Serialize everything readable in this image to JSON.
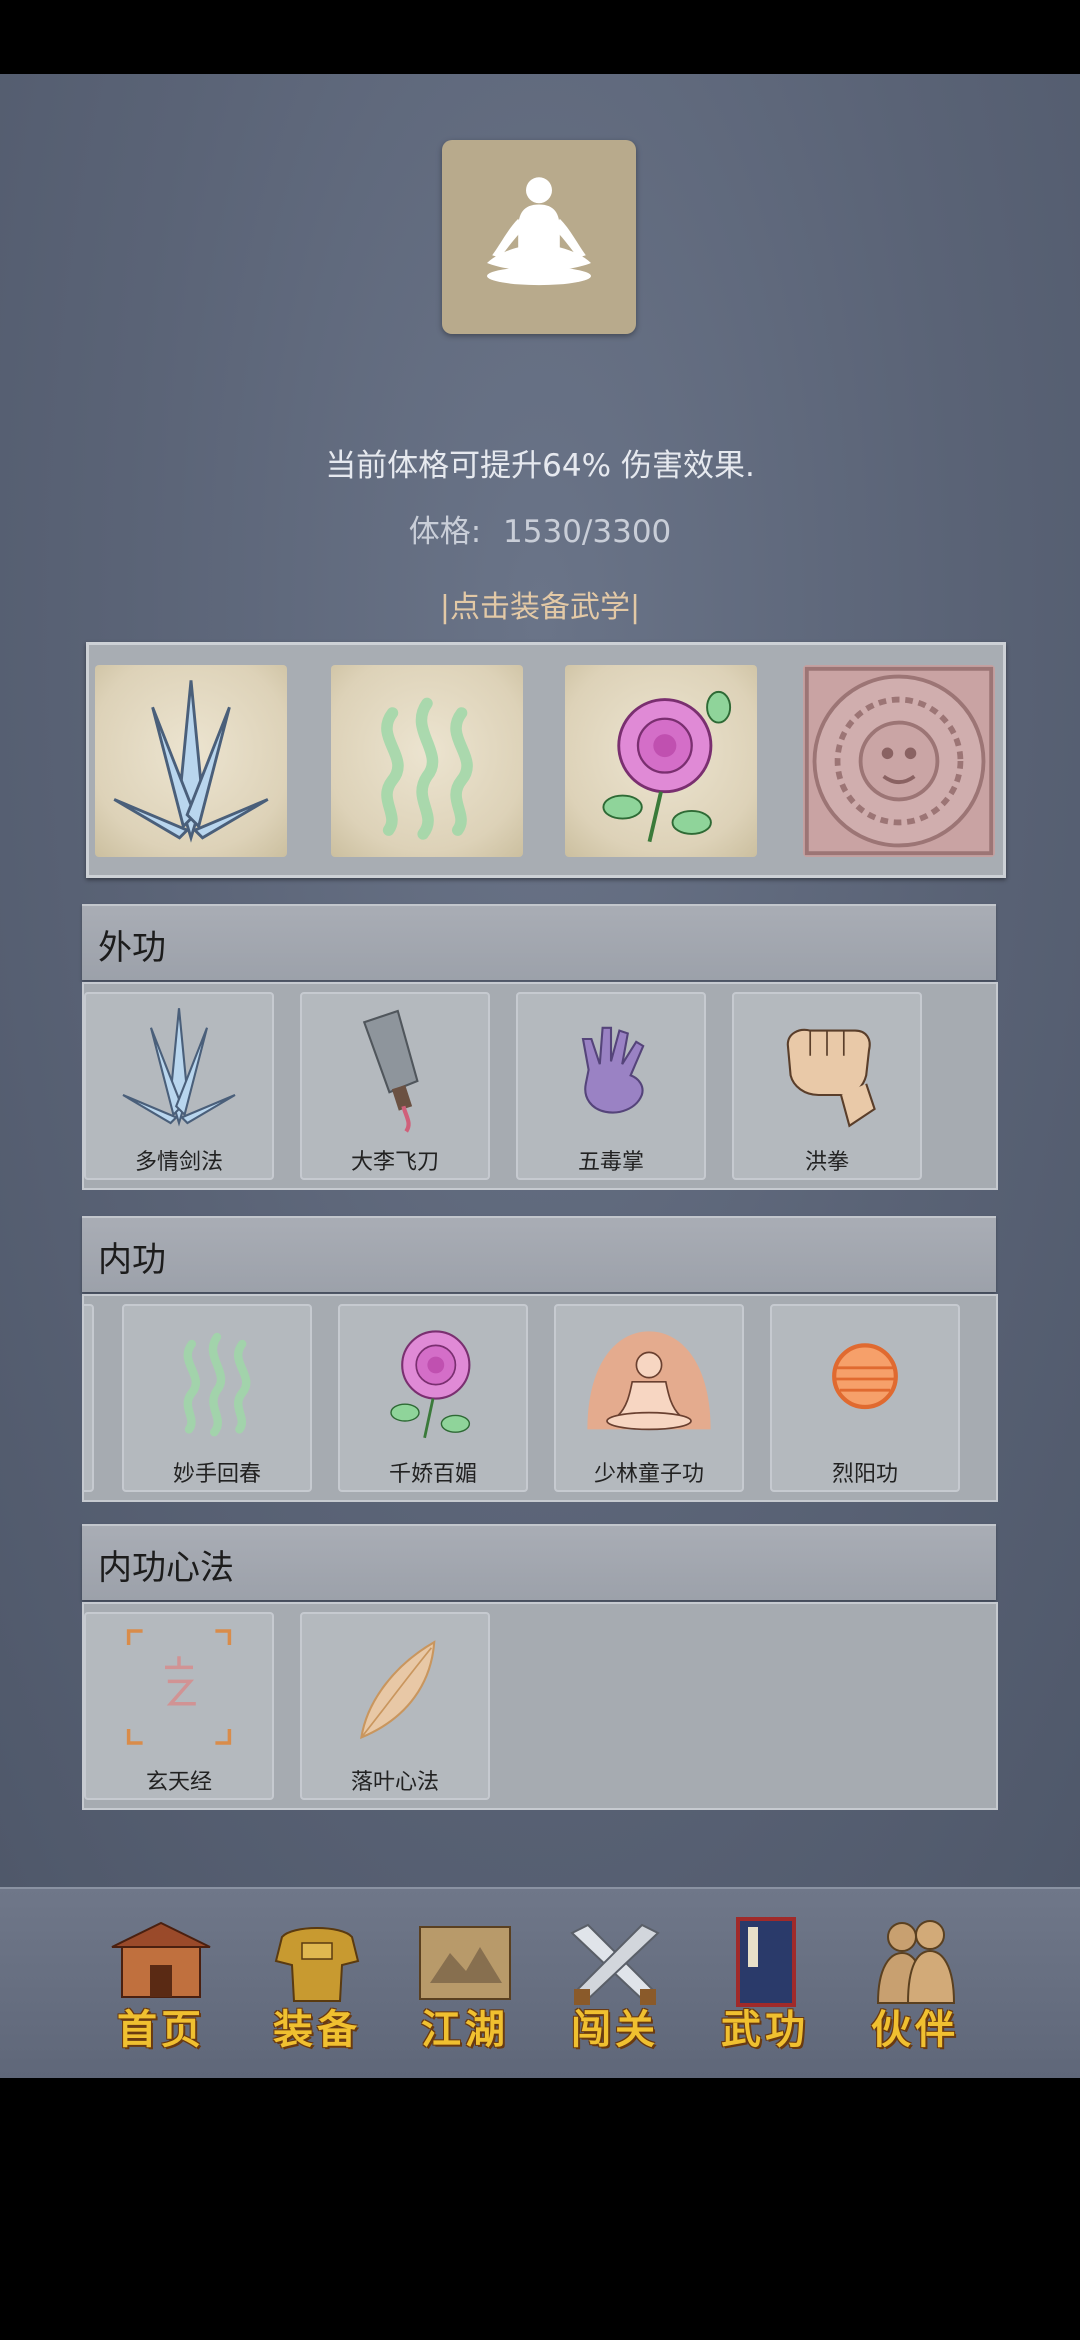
{
  "avatar": {
    "icon": "meditation-icon"
  },
  "bonus_text": "当前体格可提升64% 伤害效果.",
  "stat": {
    "label": "体格:",
    "value": "1530/3300"
  },
  "equip_link": "|点击装备武学|",
  "equipped": [
    {
      "icon": "crystal-sword-icon"
    },
    {
      "icon": "green-wave-icon"
    },
    {
      "icon": "rose-icon"
    },
    {
      "icon": "stone-calendar-icon"
    }
  ],
  "sections": {
    "waigong": {
      "title": "外功",
      "items": [
        {
          "label": "多情剑法",
          "icon": "crystal-sword-icon"
        },
        {
          "label": "大李飞刀",
          "icon": "cleaver-icon"
        },
        {
          "label": "五毒掌",
          "icon": "purple-hand-icon"
        },
        {
          "label": "洪拳",
          "icon": "fist-icon"
        }
      ]
    },
    "neigong": {
      "title": "内功",
      "items": [
        {
          "label": "妙手回春",
          "icon": "green-wave-icon"
        },
        {
          "label": "千娇百媚",
          "icon": "rose-icon"
        },
        {
          "label": "少林童子功",
          "icon": "monk-icon"
        },
        {
          "label": "烈阳功",
          "icon": "sun-orb-icon"
        }
      ]
    },
    "xinfa": {
      "title": "内功心法",
      "items": [
        {
          "label": "玄天经",
          "icon": "xuan-scroll-icon"
        },
        {
          "label": "落叶心法",
          "icon": "leaf-icon"
        }
      ]
    }
  },
  "nav": [
    {
      "label": "首页",
      "icon": "temple-icon"
    },
    {
      "label": "装备",
      "icon": "armor-icon"
    },
    {
      "label": "江湖",
      "icon": "map-scroll-icon"
    },
    {
      "label": "闯关",
      "icon": "crossed-swords-icon"
    },
    {
      "label": "武功",
      "icon": "manual-book-icon"
    },
    {
      "label": "伙伴",
      "icon": "companions-icon"
    }
  ]
}
